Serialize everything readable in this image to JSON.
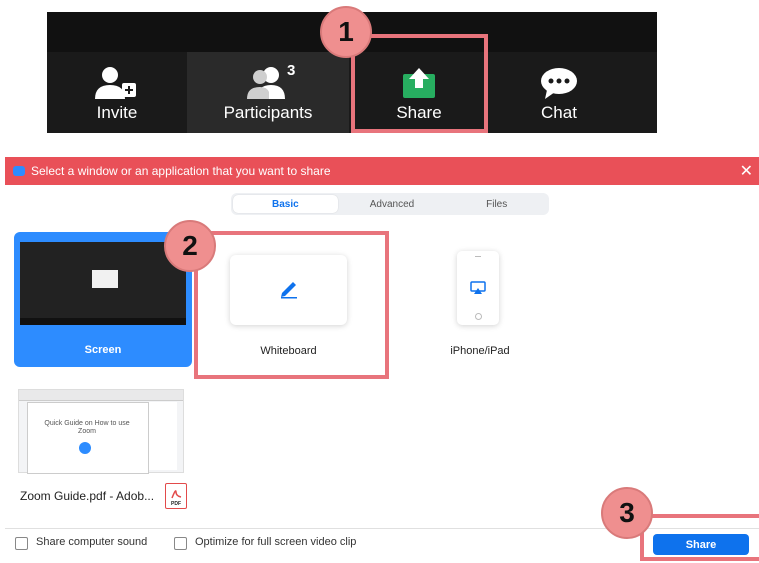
{
  "toolbar": {
    "invite_label": "Invite",
    "participants_label": "Participants",
    "participants_count": "3",
    "share_label": "Share",
    "chat_label": "Chat"
  },
  "steps": {
    "step1": "1",
    "step2": "2",
    "step3": "3"
  },
  "dialog": {
    "title": "Select a window or an application that you want to share",
    "close_glyph": "✕",
    "tabs": [
      {
        "label": "Basic",
        "active": true
      },
      {
        "label": "Advanced",
        "active": false
      },
      {
        "label": "Files",
        "active": false
      }
    ],
    "tiles": {
      "screen_label": "Screen",
      "whiteboard_label": "Whiteboard",
      "iphone_label": "iPhone/iPad",
      "pdf_label": "Zoom Guide.pdf - Adob...",
      "pdf_thumb_text": "Quick Guide on How to use Zoom",
      "pdf_icon_text": "PDF"
    },
    "footer": {
      "sound_label": "Share computer sound",
      "optimize_label": "Optimize for full screen video clip",
      "share_button": "Share"
    }
  },
  "colors": {
    "titlebar": "#e95058",
    "accent_blue": "#0e72ed",
    "share_green": "#27ae60",
    "highlight": "#e8747c",
    "badge": "#ef8f8f"
  },
  "icons": {
    "invite": "add-user-icon",
    "participants": "people-icon",
    "share": "share-screen-icon",
    "chat": "chat-bubble-icon",
    "whiteboard": "pencil-icon",
    "iphone": "airplay-icon",
    "pdf": "pdf-file-icon",
    "close": "close-icon"
  }
}
